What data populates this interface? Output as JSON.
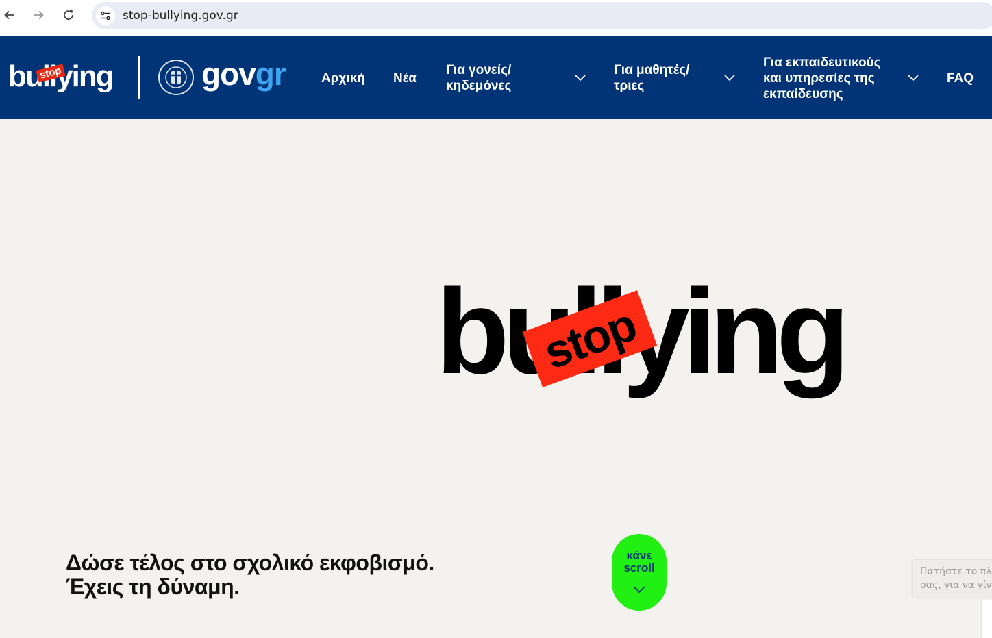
{
  "browser": {
    "url": "stop-bullying.gov.gr",
    "icons": {
      "back": "arrow-left-icon",
      "forward": "arrow-right-icon",
      "reload": "reload-icon",
      "site_info": "tune-icon"
    }
  },
  "header": {
    "logo_text": "bullying",
    "logo_tag": "stop",
    "gov_logo": {
      "part1": "gov",
      "part2": "gr"
    },
    "nav": [
      {
        "label": "Αρχική",
        "has_dropdown": false
      },
      {
        "label": "Νέα",
        "has_dropdown": false
      },
      {
        "label_line1": "Για γονείς/",
        "label_line2": "κηδεμόνες",
        "has_dropdown": true
      },
      {
        "label_line1": "Για μαθητές/",
        "label_line2": "τριες",
        "has_dropdown": true
      },
      {
        "label_line1": "Για εκπαιδευτικούς",
        "label_line2": "και υπηρεσίες της",
        "label_line3": "εκπαίδευσης",
        "has_dropdown": true
      },
      {
        "label": "FAQ",
        "has_dropdown": false
      }
    ]
  },
  "hero": {
    "logo_word": "bullying",
    "logo_stamp": "stop",
    "tagline_line1": "Δώσε τέλος στο σχολικό εκφοβισμό.",
    "tagline_line2": "Έχεις τη δύναμη.",
    "scroll_button": {
      "line1": "κάνε",
      "line2": "scroll"
    }
  },
  "side_tip": {
    "line1": "Πατήστε το πλ",
    "line2": "σας, για να γίνε"
  },
  "colors": {
    "header_bg": "#003476",
    "stamp_red": "#ff2a14",
    "scroll_green": "#22ef12",
    "gr_blue": "#3ea4f0",
    "page_bg": "#f3f2ef"
  }
}
